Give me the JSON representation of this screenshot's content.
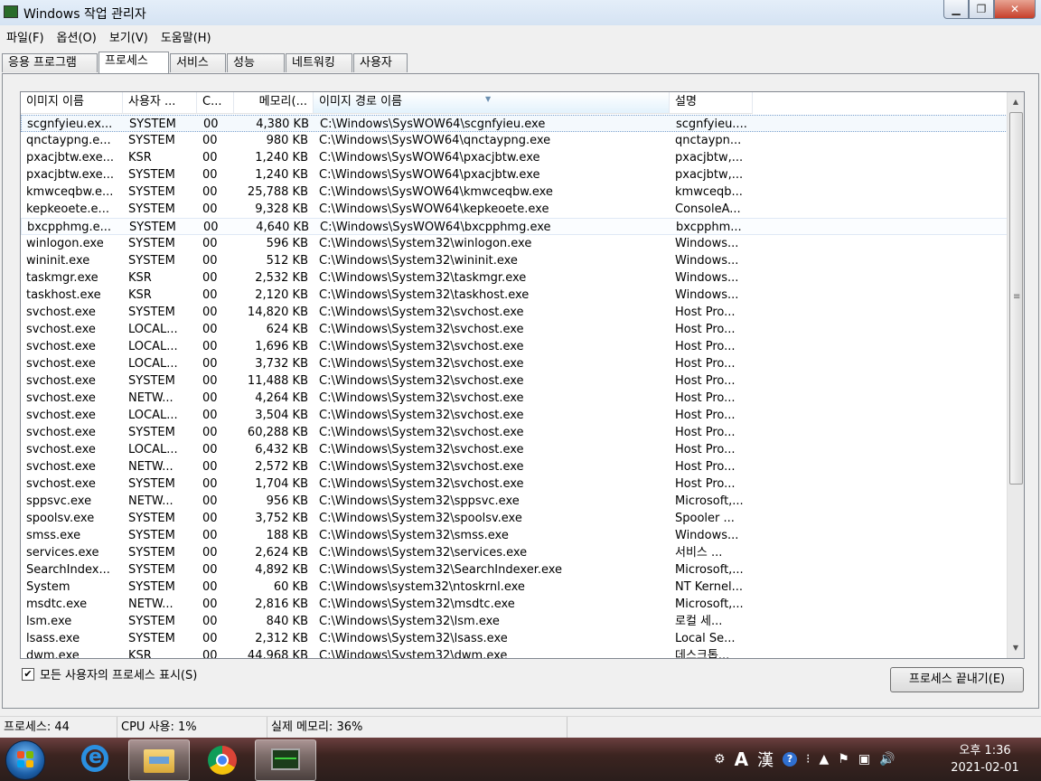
{
  "window": {
    "title": "Windows 작업 관리자"
  },
  "menu": [
    "파일(F)",
    "옵션(O)",
    "보기(V)",
    "도움말(H)"
  ],
  "tabs": [
    "응용 프로그램",
    "프로세스",
    "서비스",
    "성능",
    "네트워킹",
    "사용자"
  ],
  "columns": [
    "이미지 이름",
    "사용자 ...",
    "C...",
    "메모리(...",
    "이미지 경로 이름",
    "설명"
  ],
  "rows": [
    [
      "scgnfyieu.ex...",
      "SYSTEM",
      "00",
      "4,380 KB",
      "C:\\Windows\\SysWOW64\\scgnfyieu.exe",
      "scgnfyieu...."
    ],
    [
      "qnctaypng.e...",
      "SYSTEM",
      "00",
      "980 KB",
      "C:\\Windows\\SysWOW64\\qnctaypng.exe",
      "qnctaypn..."
    ],
    [
      "pxacjbtw.exe...",
      "KSR",
      "00",
      "1,240 KB",
      "C:\\Windows\\SysWOW64\\pxacjbtw.exe",
      "pxacjbtw,..."
    ],
    [
      "pxacjbtw.exe...",
      "SYSTEM",
      "00",
      "1,240 KB",
      "C:\\Windows\\SysWOW64\\pxacjbtw.exe",
      "pxacjbtw,..."
    ],
    [
      "kmwceqbw.e...",
      "SYSTEM",
      "00",
      "25,788 KB",
      "C:\\Windows\\SysWOW64\\kmwceqbw.exe",
      "kmwceqb..."
    ],
    [
      "kepkeoete.e...",
      "SYSTEM",
      "00",
      "9,328 KB",
      "C:\\Windows\\SysWOW64\\kepkeoete.exe",
      "ConsoleA..."
    ],
    [
      "bxcpphmg.e...",
      "SYSTEM",
      "00",
      "4,640 KB",
      "C:\\Windows\\SysWOW64\\bxcpphmg.exe",
      "bxcpphm..."
    ],
    [
      "winlogon.exe",
      "SYSTEM",
      "00",
      "596 KB",
      "C:\\Windows\\System32\\winlogon.exe",
      "Windows..."
    ],
    [
      "wininit.exe",
      "SYSTEM",
      "00",
      "512 KB",
      "C:\\Windows\\System32\\wininit.exe",
      "Windows..."
    ],
    [
      "taskmgr.exe",
      "KSR",
      "00",
      "2,532 KB",
      "C:\\Windows\\System32\\taskmgr.exe",
      "Windows..."
    ],
    [
      "taskhost.exe",
      "KSR",
      "00",
      "2,120 KB",
      "C:\\Windows\\System32\\taskhost.exe",
      "Windows..."
    ],
    [
      "svchost.exe",
      "SYSTEM",
      "00",
      "14,820 KB",
      "C:\\Windows\\System32\\svchost.exe",
      "Host Pro..."
    ],
    [
      "svchost.exe",
      "LOCAL...",
      "00",
      "624 KB",
      "C:\\Windows\\System32\\svchost.exe",
      "Host Pro..."
    ],
    [
      "svchost.exe",
      "LOCAL...",
      "00",
      "1,696 KB",
      "C:\\Windows\\System32\\svchost.exe",
      "Host Pro..."
    ],
    [
      "svchost.exe",
      "LOCAL...",
      "00",
      "3,732 KB",
      "C:\\Windows\\System32\\svchost.exe",
      "Host Pro..."
    ],
    [
      "svchost.exe",
      "SYSTEM",
      "00",
      "11,488 KB",
      "C:\\Windows\\System32\\svchost.exe",
      "Host Pro..."
    ],
    [
      "svchost.exe",
      "NETW...",
      "00",
      "4,264 KB",
      "C:\\Windows\\System32\\svchost.exe",
      "Host Pro..."
    ],
    [
      "svchost.exe",
      "LOCAL...",
      "00",
      "3,504 KB",
      "C:\\Windows\\System32\\svchost.exe",
      "Host Pro..."
    ],
    [
      "svchost.exe",
      "SYSTEM",
      "00",
      "60,288 KB",
      "C:\\Windows\\System32\\svchost.exe",
      "Host Pro..."
    ],
    [
      "svchost.exe",
      "LOCAL...",
      "00",
      "6,432 KB",
      "C:\\Windows\\System32\\svchost.exe",
      "Host Pro..."
    ],
    [
      "svchost.exe",
      "NETW...",
      "00",
      "2,572 KB",
      "C:\\Windows\\System32\\svchost.exe",
      "Host Pro..."
    ],
    [
      "svchost.exe",
      "SYSTEM",
      "00",
      "1,704 KB",
      "C:\\Windows\\System32\\svchost.exe",
      "Host Pro..."
    ],
    [
      "sppsvc.exe",
      "NETW...",
      "00",
      "956 KB",
      "C:\\Windows\\System32\\sppsvc.exe",
      "Microsoft,..."
    ],
    [
      "spoolsv.exe",
      "SYSTEM",
      "00",
      "3,752 KB",
      "C:\\Windows\\System32\\spoolsv.exe",
      "Spooler ..."
    ],
    [
      "smss.exe",
      "SYSTEM",
      "00",
      "188 KB",
      "C:\\Windows\\System32\\smss.exe",
      "Windows..."
    ],
    [
      "services.exe",
      "SYSTEM",
      "00",
      "2,624 KB",
      "C:\\Windows\\System32\\services.exe",
      "서비스 ..."
    ],
    [
      "SearchIndex...",
      "SYSTEM",
      "00",
      "4,892 KB",
      "C:\\Windows\\System32\\SearchIndexer.exe",
      "Microsoft,..."
    ],
    [
      "System",
      "SYSTEM",
      "00",
      "60 KB",
      "C:\\Windows\\system32\\ntoskrnl.exe",
      "NT Kernel..."
    ],
    [
      "msdtc.exe",
      "NETW...",
      "00",
      "2,816 KB",
      "C:\\Windows\\System32\\msdtc.exe",
      "Microsoft,..."
    ],
    [
      "lsm.exe",
      "SYSTEM",
      "00",
      "840 KB",
      "C:\\Windows\\System32\\lsm.exe",
      "로컬 세..."
    ],
    [
      "lsass.exe",
      "SYSTEM",
      "00",
      "2,312 KB",
      "C:\\Windows\\System32\\lsass.exe",
      "Local Se..."
    ],
    [
      "dwm.exe",
      "KSR",
      "00",
      "44,968 KB",
      "C:\\Windows\\System32\\dwm.exe",
      "데스크톱..."
    ]
  ],
  "show_all": {
    "label": "모든 사용자의 프로세스 표시(S)",
    "checked": "✔"
  },
  "end_button": "프로세스 끝내기(E)",
  "status": [
    "프로세스: 44",
    "CPU 사용: 1%",
    "실제 메모리: 36%"
  ],
  "tray": {
    "ime_a": "A",
    "ime_han": "漢",
    "help": "?"
  },
  "clock": {
    "time": "오후 1:36",
    "date": "2021-02-01"
  },
  "colors": {
    "selection_border": "#7da2ce",
    "header_sorted": "#e3f2fc",
    "taskbar": "#3c2420"
  }
}
